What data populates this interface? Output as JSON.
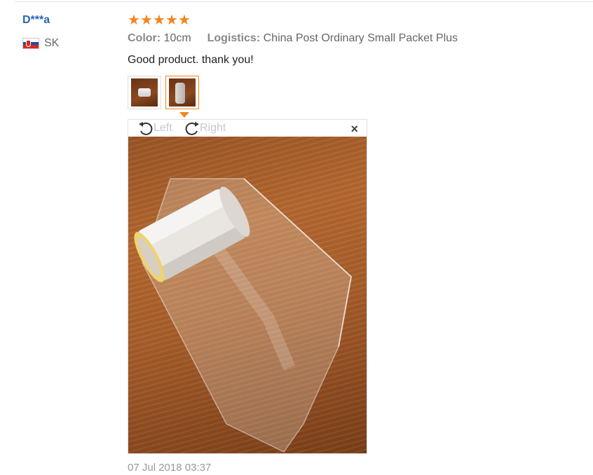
{
  "review": {
    "user_name": "D***a",
    "country_code": "SK",
    "rating": 5,
    "attributes": {
      "color_label": "Color:",
      "color_value": "10cm",
      "logistics_label": "Logistics:",
      "logistics_value": "China Post Ordinary Small Packet Plus"
    },
    "text": "Good product. thank you!",
    "timestamp": "07 Jul 2018 03:37"
  },
  "viewer": {
    "rotate_left_label": "Left",
    "rotate_right_label": "Right",
    "close_symbol": "×"
  },
  "icons": {
    "star": "star-icon",
    "rotate_left": "rotate-left-icon",
    "rotate_right": "rotate-right-icon",
    "close": "close-icon",
    "flag": "slovakia-flag-icon"
  },
  "colors": {
    "accent": "#f5841f",
    "username": "#2a64b4"
  }
}
